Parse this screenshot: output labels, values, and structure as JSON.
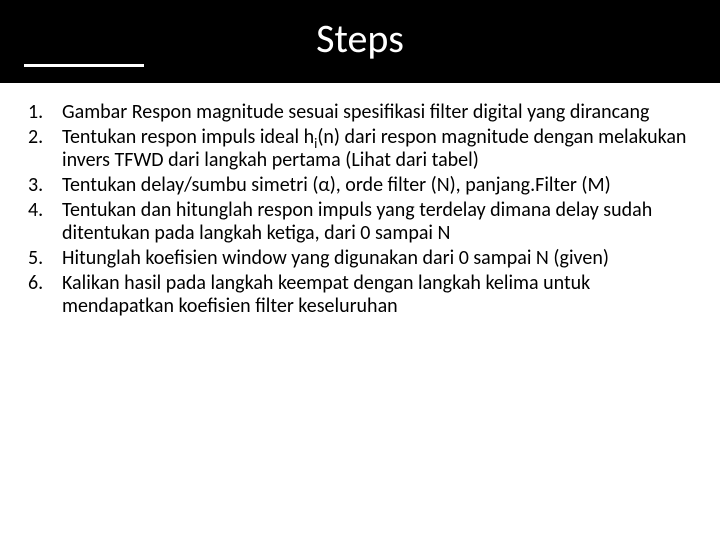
{
  "title": "Steps",
  "items": [
    {
      "num": "1.",
      "text": "Gambar Respon magnitude sesuai spesifikasi filter digital yang dirancang"
    },
    {
      "num": "2.",
      "text": "Tentukan respon impuls ideal h_i(n) dari respon magnitude dengan melakukan invers TFWD dari langkah pertama (Lihat dari tabel)"
    },
    {
      "num": "3.",
      "text": "Tentukan delay/sumbu simetri (α), orde filter (N), panjang.Filter (M)"
    },
    {
      "num": "4.",
      "text": "Tentukan dan hitunglah respon impuls yang terdelay dimana delay sudah ditentukan pada langkah ketiga, dari 0 sampai N"
    },
    {
      "num": "5.",
      "text": "Hitunglah koefisien window yang digunakan dari 0 sampai N (given)"
    },
    {
      "num": "6.",
      "text": "Kalikan hasil pada langkah keempat dengan langkah kelima untuk mendapatkan koefisien filter keseluruhan"
    }
  ]
}
